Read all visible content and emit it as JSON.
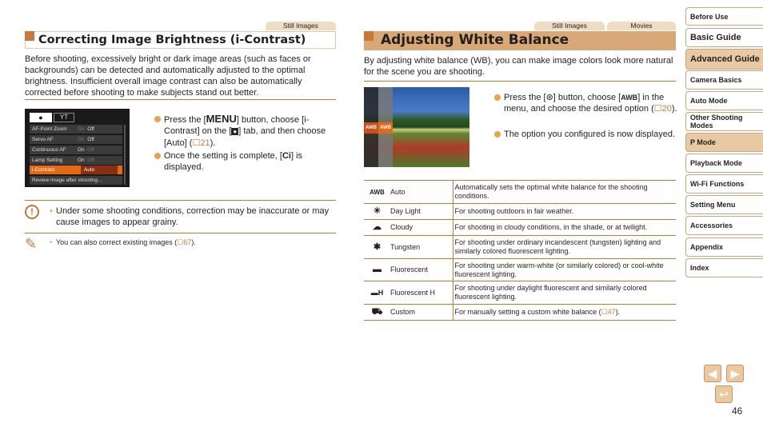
{
  "left_section": {
    "tab": "Still Images",
    "title": "Correcting Image Brightness (i-Contrast)",
    "intro": "Before shooting, excessively bright or dark image areas (such as faces or backgrounds) can be detected and automatically adjusted to the optimal brightness. Insufficient overall image contrast can also be automatically corrected before shooting to make subjects stand out better.",
    "camera_menu": {
      "tabs": [
        "camera-icon",
        "tools-icon"
      ],
      "rows": [
        {
          "label": "AF-Point Zoom",
          "on": "On",
          "off": "Off",
          "selected": "Off"
        },
        {
          "label": "Servo AF",
          "on": "On",
          "off": "Off",
          "selected": "Off"
        },
        {
          "label": "Continuous AF",
          "on": "On",
          "off": "Off",
          "selected": "On"
        },
        {
          "label": "Lamp Setting",
          "on": "On",
          "off": "Off",
          "selected": "On"
        },
        {
          "label": "i-Contrast",
          "value": "Auto",
          "highlighted": true
        },
        {
          "label": "Review image after shooting..."
        }
      ]
    },
    "steps": [
      {
        "pre": "Press the [",
        "key": "MENU",
        "mid": "] button, choose [i-Contrast] on the [",
        "icon": "camera",
        "post": "] tab, and then choose [Auto] (",
        "ref": "21",
        "end": ")."
      },
      {
        "pre": "Once the setting is complete, [",
        "icon": "Ci",
        "post": "] is displayed."
      }
    ],
    "caution": "Under some shooting conditions, correction may be inaccurate or may cause images to appear grainy.",
    "note_pre": "You can also correct existing images (",
    "note_ref": "67",
    "note_post": ")."
  },
  "right_section": {
    "tabs": [
      "Still Images",
      "Movies"
    ],
    "title": "Adjusting White Balance",
    "intro": "By adjusting white balance (WB), you can make image colors look more natural for the scene you are shooting.",
    "steps": [
      {
        "pre": "Press the [",
        "icon": "func-set",
        "mid": "] button, choose [",
        "icon2": "AWB",
        "post": "] in the menu, and choose the desired option (",
        "ref": "20",
        "end": ")."
      },
      {
        "text": "The option you configured is now displayed."
      }
    ],
    "photo_menu": [
      "AWB",
      "AWB"
    ],
    "table": [
      {
        "icon": "AWB",
        "name": "Auto",
        "desc": "Automatically sets the optimal white balance for the shooting conditions."
      },
      {
        "icon": "☀",
        "name": "Day Light",
        "desc": "For shooting outdoors in fair weather."
      },
      {
        "icon": "☁",
        "name": "Cloudy",
        "desc": "For shooting in cloudy conditions, in the shade, or at twilight."
      },
      {
        "icon": "✱",
        "name": "Tungsten",
        "desc": "For shooting under ordinary incandescent (tungsten) lighting and similarly colored fluorescent lighting."
      },
      {
        "icon": "▬",
        "name": "Fluorescent",
        "desc": "For shooting under warm-white (or similarly colored) or cool-white fluorescent lighting."
      },
      {
        "icon": "▬H",
        "name": "Fluorescent H",
        "desc": "For shooting under daylight fluorescent and similarly colored fluorescent lighting."
      },
      {
        "icon": "⛟",
        "name": "Custom",
        "desc_pre": "For manually setting a custom white balance (",
        "ref": "47",
        "desc_post": ")."
      }
    ]
  },
  "sidebar": {
    "items": [
      {
        "label": "Before Use"
      },
      {
        "label": "Basic Guide"
      },
      {
        "label": "Advanced Guide",
        "active": true
      },
      {
        "label": "Camera Basics"
      },
      {
        "label": "Auto Mode"
      },
      {
        "label": "Other Shooting Modes"
      },
      {
        "label": "P Mode",
        "active": true
      },
      {
        "label": "Playback Mode"
      },
      {
        "label": "Wi-Fi Functions"
      },
      {
        "label": "Setting Menu"
      },
      {
        "label": "Accessories"
      },
      {
        "label": "Appendix"
      },
      {
        "label": "Index"
      }
    ]
  },
  "nav": {
    "prev": "◀",
    "next": "▶",
    "back": "↩"
  },
  "page_number": "46",
  "colors": {
    "accent": "#c8793a",
    "tab_bg": "#efdcc5",
    "active_bg": "#e9c9a4",
    "rule": "#b97a3b",
    "bullet": "#e9a54b"
  }
}
